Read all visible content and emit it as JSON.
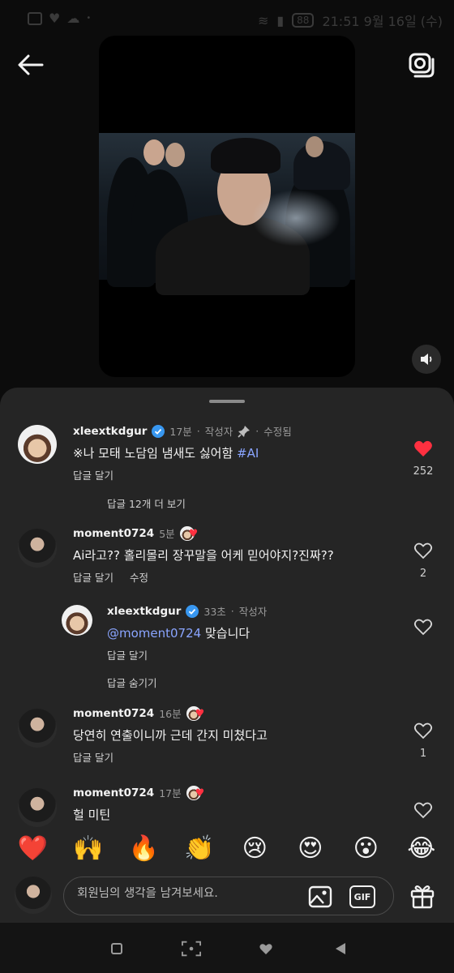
{
  "status_bar": {
    "time": "21:51 9월 16일 (수)",
    "battery": "88"
  },
  "comments": [
    {
      "username": "xleextkdgur",
      "time": "17분",
      "author_tag": "작성자",
      "edited": "수정됨",
      "text_prefix": "※나 모태 노담임 냄새도 싫어함 ",
      "hashtag": "#AI",
      "reply": "답글 달기",
      "likes": "252",
      "liked": true
    },
    {
      "username": "moment0724",
      "time": "5분",
      "text": "Ai라고?? 홀리몰리 장꾸말을 어케 믿어야지?진짜??",
      "reply": "답글 달기",
      "edit": "수정",
      "likes": "2",
      "liked": false
    },
    {
      "username": "xleextkdgur",
      "time": "33초",
      "author_tag": "작성자",
      "mention": "@moment0724",
      "text_suffix": " 맞습니다",
      "reply": "답글 달기",
      "liked": false
    },
    {
      "username": "moment0724",
      "time": "16분",
      "text": "당연히 연출이니까 근데 간지 미쳤다고",
      "reply": "답글 달기",
      "likes": "1",
      "liked": false
    },
    {
      "username": "moment0724",
      "time": "17분",
      "text": "헐 미틴",
      "liked": false
    }
  ],
  "view_more": "답글 12개 더 보기",
  "hide_replies": "답글 숨기기",
  "reactions": [
    "❤️",
    "🙌",
    "🔥",
    "👏",
    "😢",
    "😍",
    "😮",
    "😂"
  ],
  "input": {
    "placeholder": "회원님의 생각을 남겨보세요.",
    "gif_label": "GIF"
  },
  "colors": {
    "sheet": "#252525",
    "accent": "#8aa5ff",
    "like": "#ff3040",
    "verified": "#3897f0"
  }
}
